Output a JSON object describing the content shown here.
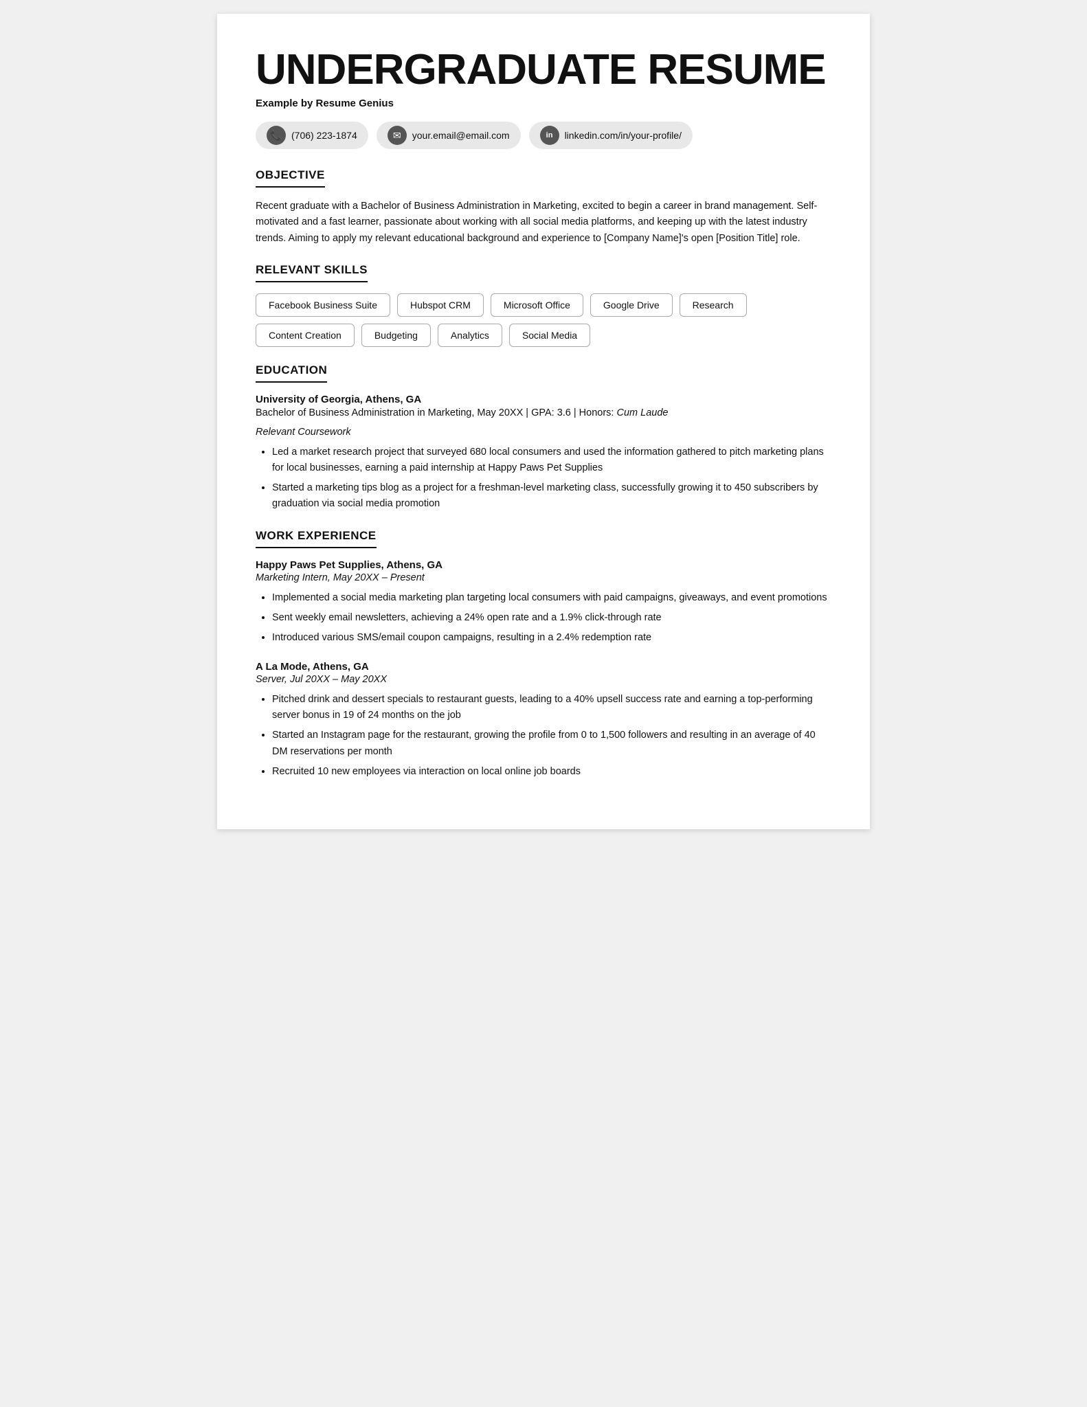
{
  "resume": {
    "title": "UNDERGRADUATE RESUME",
    "byline": "Example by Resume Genius",
    "contact": {
      "phone": "(706) 223-1874",
      "email": "your.email@email.com",
      "linkedin": "linkedin.com/in/your-profile/"
    },
    "objective": {
      "section_title": "OBJECTIVE",
      "text": "Recent graduate with a Bachelor of Business Administration in Marketing, excited to begin a career in brand management. Self-motivated and a fast learner, passionate about working with all social media platforms, and keeping up with the latest industry trends. Aiming to apply my relevant educational background and experience to [Company Name]'s open [Position Title] role."
    },
    "skills": {
      "section_title": "RELEVANT SKILLS",
      "items": [
        "Facebook Business Suite",
        "Hubspot CRM",
        "Microsoft Office",
        "Google Drive",
        "Research",
        "Content Creation",
        "Budgeting",
        "Analytics",
        "Social Media"
      ]
    },
    "education": {
      "section_title": "EDUCATION",
      "school": "University of Georgia, Athens, GA",
      "degree": "Bachelor of Business Administration in Marketing, May 20XX | GPA: 3.6 | Honors:",
      "honors": "Cum Laude",
      "coursework_label": "Relevant Coursework",
      "bullets": [
        "Led a market research project that surveyed 680 local consumers and used the information gathered to pitch marketing plans for local businesses, earning a paid internship at Happy Paws Pet Supplies",
        "Started a marketing tips blog as a project for a freshman-level marketing class, successfully growing it to 450 subscribers by graduation via social media promotion"
      ]
    },
    "work_experience": {
      "section_title": "WORK EXPERIENCE",
      "jobs": [
        {
          "company": "Happy Paws Pet Supplies, Athens, GA",
          "title": "Marketing Intern, May 20XX – Present",
          "bullets": [
            "Implemented a social media marketing plan targeting local consumers with paid campaigns, giveaways, and event promotions",
            "Sent weekly email newsletters, achieving a 24% open rate and a 1.9% click-through rate",
            "Introduced various SMS/email coupon campaigns, resulting in a 2.4% redemption rate"
          ]
        },
        {
          "company": "A La Mode, Athens, GA",
          "title": "Server, Jul 20XX – May 20XX",
          "bullets": [
            "Pitched drink and dessert specials to restaurant guests, leading to a 40% upsell success rate and earning a top-performing server bonus in 19 of 24 months on the job",
            "Started an Instagram page for the restaurant, growing the profile from 0 to 1,500 followers and resulting in an average of 40 DM reservations per month",
            "Recruited 10 new employees via interaction on local online job boards"
          ]
        }
      ]
    }
  }
}
